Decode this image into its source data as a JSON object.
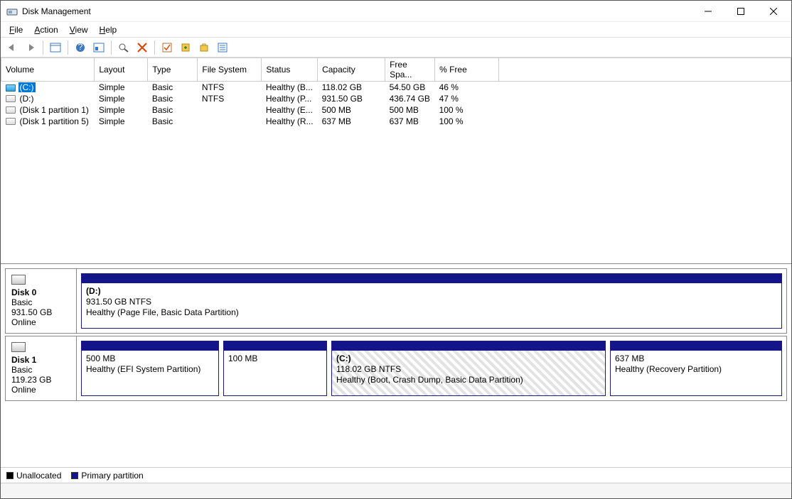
{
  "window": {
    "title": "Disk Management"
  },
  "menubar": {
    "file": "File",
    "action": "Action",
    "view": "View",
    "help": "Help"
  },
  "columns": {
    "volume": "Volume",
    "layout": "Layout",
    "type": "Type",
    "filesystem": "File System",
    "status": "Status",
    "capacity": "Capacity",
    "free": "Free Spa...",
    "percent": "% Free"
  },
  "volumes": [
    {
      "selected": true,
      "icon": "c",
      "name": "(C:)",
      "layout": "Simple",
      "type": "Basic",
      "fs": "NTFS",
      "status": "Healthy (B...",
      "capacity": "118.02 GB",
      "free": "54.50 GB",
      "percent": "46 %"
    },
    {
      "selected": false,
      "icon": "d",
      "name": "(D:)",
      "layout": "Simple",
      "type": "Basic",
      "fs": "NTFS",
      "status": "Healthy (P...",
      "capacity": "931.50 GB",
      "free": "436.74 GB",
      "percent": "47 %"
    },
    {
      "selected": false,
      "icon": "p",
      "name": "(Disk 1 partition 1)",
      "layout": "Simple",
      "type": "Basic",
      "fs": "",
      "status": "Healthy (E...",
      "capacity": "500 MB",
      "free": "500 MB",
      "percent": "100 %"
    },
    {
      "selected": false,
      "icon": "p",
      "name": "(Disk 1 partition 5)",
      "layout": "Simple",
      "type": "Basic",
      "fs": "",
      "status": "Healthy (R...",
      "capacity": "637 MB",
      "free": "637 MB",
      "percent": "100 %"
    }
  ],
  "disks": {
    "d0": {
      "name": "Disk 0",
      "type": "Basic",
      "size": "931.50 GB",
      "status": "Online",
      "parts": [
        {
          "selected": false,
          "label": "(D:)",
          "line2": "931.50 GB NTFS",
          "line3": "Healthy (Page File, Basic Data Partition)",
          "flex": 1
        }
      ]
    },
    "d1": {
      "name": "Disk 1",
      "type": "Basic",
      "size": "119.23 GB",
      "status": "Online",
      "parts": [
        {
          "selected": false,
          "label": "",
          "line2": "500 MB",
          "line3": "Healthy (EFI System Partition)",
          "flex": 0.2
        },
        {
          "selected": false,
          "label": "",
          "line2": "100 MB",
          "line3": "",
          "flex": 0.15
        },
        {
          "selected": true,
          "label": "(C:)",
          "line2": "118.02 GB NTFS",
          "line3": "Healthy (Boot, Crash Dump, Basic Data Partition)",
          "flex": 0.4
        },
        {
          "selected": false,
          "label": "",
          "line2": "637 MB",
          "line3": "Healthy (Recovery Partition)",
          "flex": 0.25
        }
      ]
    }
  },
  "legend": {
    "unallocated": "Unallocated",
    "primary": "Primary partition"
  }
}
